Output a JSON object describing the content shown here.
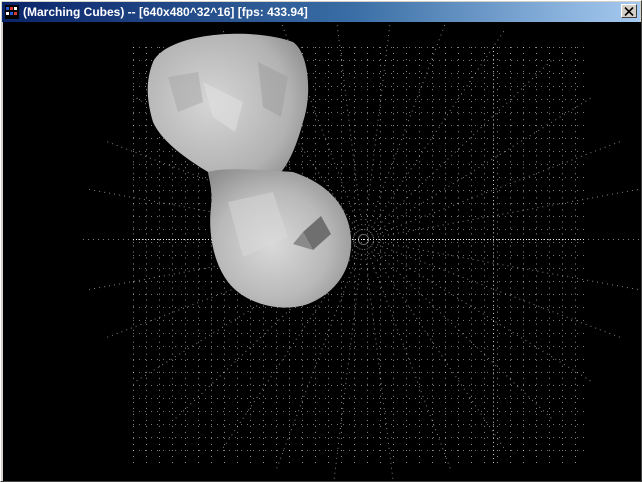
{
  "window": {
    "title": "(Marching Cubes) -- [640x480^32^16] [fps: 433.94]",
    "icon": "opengl-app-icon",
    "close_icon": "close-icon"
  },
  "scene": {
    "background": "#000000",
    "grid_point_color": "#ffffff",
    "surface_color": "#c8c8c8",
    "description_icon": "marching-cubes-mesh"
  },
  "colors": {
    "title_active_start": "#0a246a",
    "title_active_end": "#a6caf0",
    "frame": "#d4d0c8"
  }
}
